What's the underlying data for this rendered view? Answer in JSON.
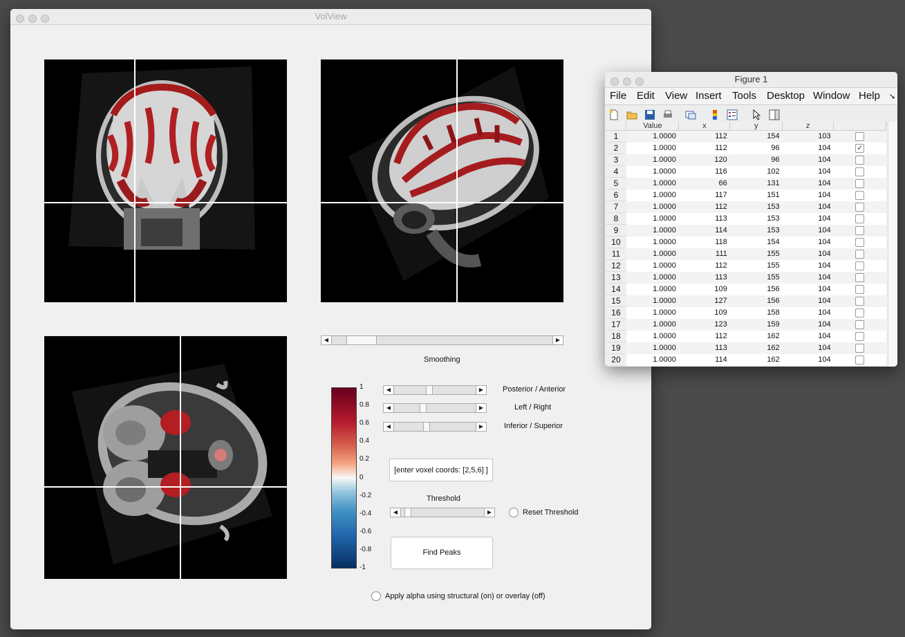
{
  "volview": {
    "title": "VolView",
    "smoothing_label": "Smoothing",
    "sliders": [
      {
        "label": "Posterior / Anterior",
        "value": 0.42
      },
      {
        "label": "Left / Right",
        "value": 0.34
      },
      {
        "label": "Inferior / Superior",
        "value": 0.38
      }
    ],
    "smoothing_value": 0.08,
    "threshold_value": 0.05,
    "voxel_input_value": "[enter voxel coords: [2,5,6] ]",
    "threshold_label": "Threshold",
    "reset_threshold_label": "Reset Threshold",
    "find_peaks_label": "Find Peaks",
    "alpha_label": "Apply alpha using structural (on) or overlay (off)",
    "colorbar_ticks": [
      "1",
      "0.8",
      "0.6",
      "0.4",
      "0.2",
      "0",
      "-0.2",
      "-0.4",
      "-0.6",
      "-0.8",
      "-1"
    ],
    "colors": {
      "high": "#67001f",
      "mid": "#f7f7f7",
      "low": "#053061"
    },
    "views": [
      {
        "name": "coronal-view-icon"
      },
      {
        "name": "sagittal-view-icon"
      },
      {
        "name": "axial-view-icon"
      }
    ]
  },
  "figure": {
    "title": "Figure 1",
    "menu": [
      "File",
      "Edit",
      "View",
      "Insert",
      "Tools",
      "Desktop",
      "Window",
      "Help"
    ],
    "toolbar_icons": [
      "new-file-icon",
      "open-folder-icon",
      "save-icon",
      "print-icon",
      "link-plot-icon",
      "colorbar-icon",
      "legend-icon",
      "pointer-icon",
      "property-editor-icon"
    ],
    "columns": [
      "Value",
      "x",
      "y",
      "z"
    ],
    "rows": [
      {
        "n": "1",
        "value": "1.0000",
        "x": "112",
        "y": "154",
        "z": "103",
        "checked": false
      },
      {
        "n": "2",
        "value": "1.0000",
        "x": "112",
        "y": "96",
        "z": "104",
        "checked": true
      },
      {
        "n": "3",
        "value": "1.0000",
        "x": "120",
        "y": "96",
        "z": "104",
        "checked": false
      },
      {
        "n": "4",
        "value": "1.0000",
        "x": "116",
        "y": "102",
        "z": "104",
        "checked": false
      },
      {
        "n": "5",
        "value": "1.0000",
        "x": "66",
        "y": "131",
        "z": "104",
        "checked": false
      },
      {
        "n": "6",
        "value": "1.0000",
        "x": "117",
        "y": "151",
        "z": "104",
        "checked": false
      },
      {
        "n": "7",
        "value": "1.0000",
        "x": "112",
        "y": "153",
        "z": "104",
        "checked": false
      },
      {
        "n": "8",
        "value": "1.0000",
        "x": "113",
        "y": "153",
        "z": "104",
        "checked": false
      },
      {
        "n": "9",
        "value": "1.0000",
        "x": "114",
        "y": "153",
        "z": "104",
        "checked": false
      },
      {
        "n": "10",
        "value": "1.0000",
        "x": "118",
        "y": "154",
        "z": "104",
        "checked": false
      },
      {
        "n": "11",
        "value": "1.0000",
        "x": "111",
        "y": "155",
        "z": "104",
        "checked": false
      },
      {
        "n": "12",
        "value": "1.0000",
        "x": "112",
        "y": "155",
        "z": "104",
        "checked": false
      },
      {
        "n": "13",
        "value": "1.0000",
        "x": "113",
        "y": "155",
        "z": "104",
        "checked": false
      },
      {
        "n": "14",
        "value": "1.0000",
        "x": "109",
        "y": "156",
        "z": "104",
        "checked": false
      },
      {
        "n": "15",
        "value": "1.0000",
        "x": "127",
        "y": "156",
        "z": "104",
        "checked": false
      },
      {
        "n": "16",
        "value": "1.0000",
        "x": "109",
        "y": "158",
        "z": "104",
        "checked": false
      },
      {
        "n": "17",
        "value": "1.0000",
        "x": "123",
        "y": "159",
        "z": "104",
        "checked": false
      },
      {
        "n": "18",
        "value": "1.0000",
        "x": "112",
        "y": "162",
        "z": "104",
        "checked": false
      },
      {
        "n": "19",
        "value": "1.0000",
        "x": "113",
        "y": "162",
        "z": "104",
        "checked": false
      },
      {
        "n": "20",
        "value": "1.0000",
        "x": "114",
        "y": "162",
        "z": "104",
        "checked": false
      }
    ]
  }
}
